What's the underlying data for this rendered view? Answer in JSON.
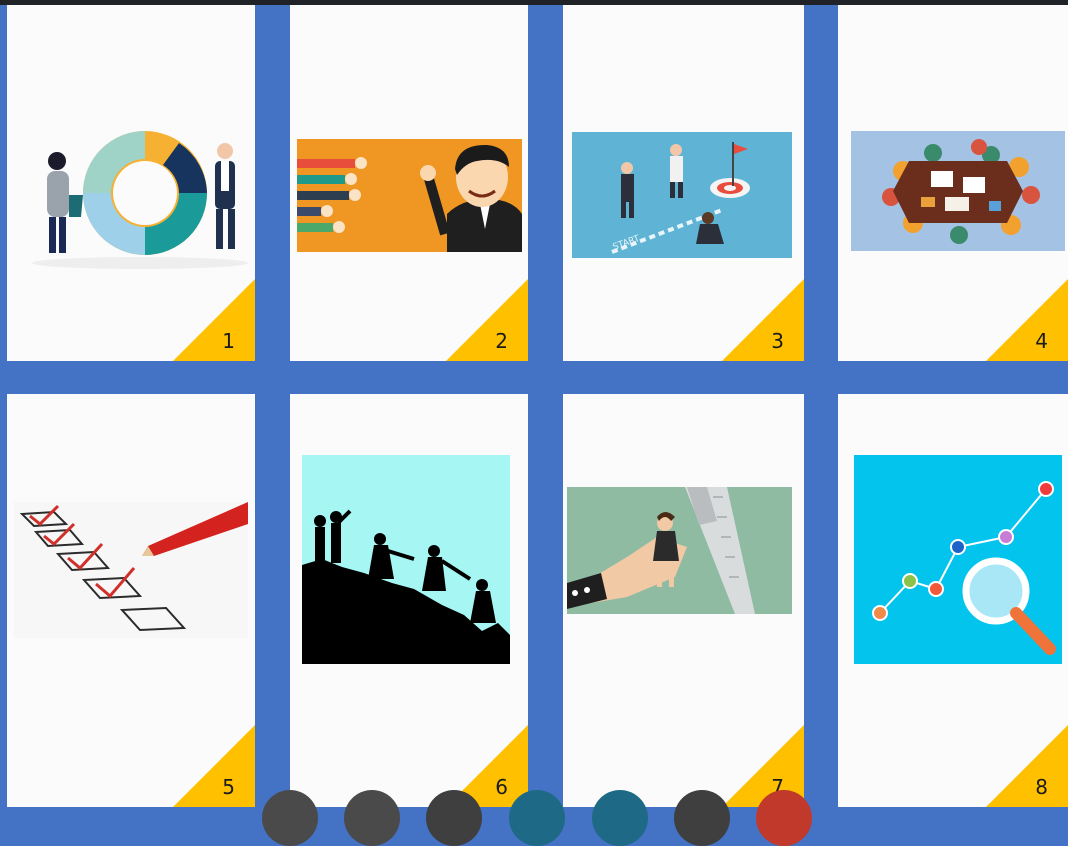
{
  "cards": [
    {
      "number": "1",
      "image": "people-assembling-puzzle-circle-illustration"
    },
    {
      "number": "2",
      "image": "businessman-with-thumbs-up-ratings-illustration"
    },
    {
      "number": "3",
      "image": "business-people-start-line-to-target-illustration"
    },
    {
      "number": "4",
      "image": "team-meeting-around-table-top-view-illustration"
    },
    {
      "number": "5",
      "image": "checklist-with-red-pencil-photo"
    },
    {
      "number": "6",
      "image": "silhouettes-helping-climb-mountain-illustration"
    },
    {
      "number": "7",
      "image": "hand-holding-businesswoman-in-caliper-illustration"
    },
    {
      "number": "8",
      "image": "magnifier-over-data-chart-illustration"
    }
  ],
  "colors": {
    "background": "#4472c4",
    "card": "#fbfbfb",
    "corner": "#ffc000"
  },
  "taskbar_icons": [
    "app-icon",
    "app-icon",
    "app-icon",
    "app-icon",
    "app-icon",
    "app-icon",
    "app-icon"
  ]
}
